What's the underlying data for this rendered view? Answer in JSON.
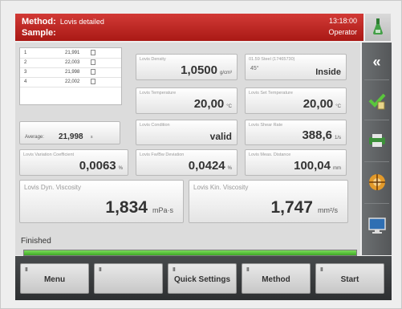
{
  "header": {
    "method_key": "Method:",
    "method_value": "Lovis detailed",
    "sample_key": "Sample:",
    "time": "13:18:00",
    "user": "Operator"
  },
  "table": {
    "rows": [
      {
        "index": "1",
        "value": "21,991",
        "unit": "s"
      },
      {
        "index": "2",
        "value": "22,003",
        "unit": "s"
      },
      {
        "index": "3",
        "value": "21,998",
        "unit": "s"
      },
      {
        "index": "4",
        "value": "22,002",
        "unit": "s"
      }
    ],
    "average_label": "Average:",
    "average_value": "21,998",
    "average_unit": "s"
  },
  "tiles": {
    "density": {
      "label": "Lovis Density",
      "value": "1,0500",
      "unit": "g/cm³"
    },
    "ball": {
      "label": "01.59 Steel (17465730)",
      "angle": "45°",
      "value": "Inside"
    },
    "temperature": {
      "label": "Lovis Temperature",
      "value": "20,00",
      "unit": "°C"
    },
    "set_temperature": {
      "label": "Lovis Set Temperature",
      "value": "20,00",
      "unit": "°C"
    },
    "condition": {
      "label": "Lovis Condition",
      "value": "valid"
    },
    "shear_rate": {
      "label": "Lovis Shear Rate",
      "value": "388,6",
      "unit": "1/s"
    },
    "variation": {
      "label": "Lovis Variation Coefficient",
      "value": "0,0063",
      "unit": "%"
    },
    "fwd_bwd": {
      "label": "Lovis Fw/Bw Deviation",
      "value": "0,0424",
      "unit": "%"
    },
    "distance": {
      "label": "Lovis Meas. Distance",
      "value": "100,04",
      "unit": "mm"
    },
    "dyn_visc": {
      "label": "Lovis Dyn. Viscosity",
      "value": "1,834",
      "unit": "mPa·s"
    },
    "kin_visc": {
      "label": "Lovis Kin. Viscosity",
      "value": "1,747",
      "unit": "mm²/s"
    }
  },
  "status": {
    "text": "Finished",
    "progress": 1.0
  },
  "sidebar": {
    "buttons": [
      "collapse-icon",
      "check-report-icon",
      "printer-icon",
      "sample-changer-icon",
      "monitor-icon"
    ]
  },
  "toolbar": {
    "indicator": "III",
    "buttons": [
      {
        "label": "Menu"
      },
      {
        "label": ""
      },
      {
        "label": "Quick Settings"
      },
      {
        "label": "Method"
      },
      {
        "label": "Start"
      }
    ]
  },
  "colors": {
    "header": "#b92420",
    "progress": "#4fc034",
    "sidebar": "#5f6264",
    "toolbar": "#3a3c3e"
  }
}
